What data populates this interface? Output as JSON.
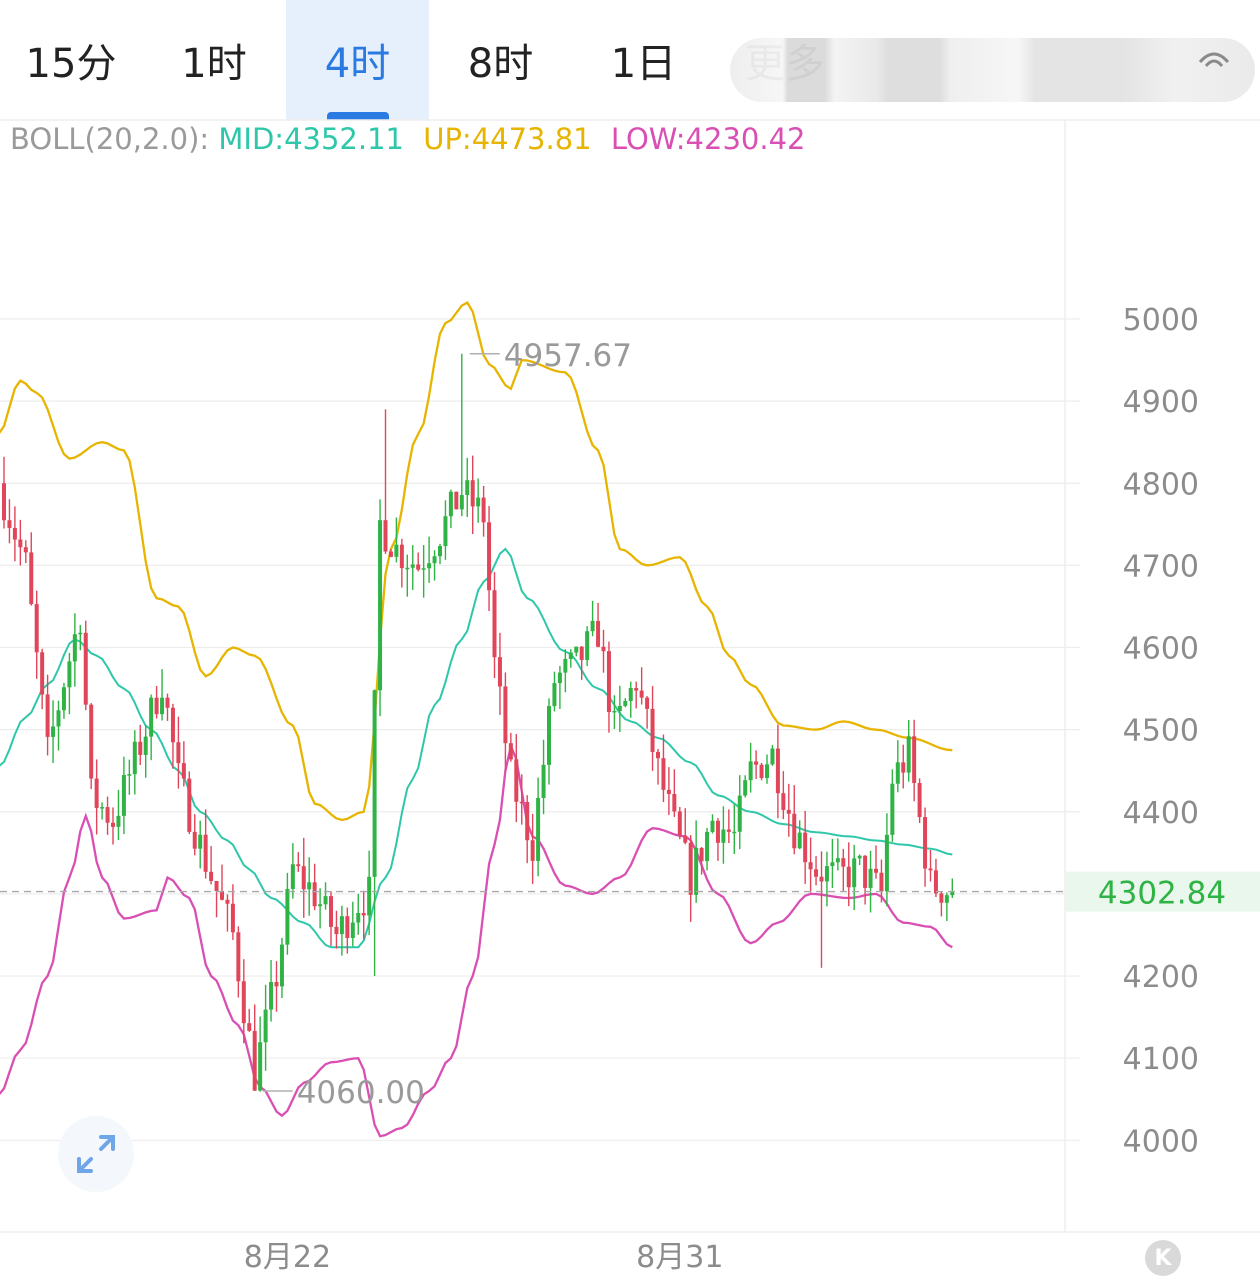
{
  "tabs": [
    {
      "label": "15分",
      "active": false
    },
    {
      "label": "1时",
      "active": false
    },
    {
      "label": "4时",
      "active": true
    },
    {
      "label": "8时",
      "active": false
    },
    {
      "label": "1日",
      "active": false
    }
  ],
  "more_tab_partial": "更多",
  "boll": {
    "label": "BOLL(20,2.0):",
    "mid": "MID:4352.11",
    "up": "UP:4473.81",
    "low": "LOW:4230.42"
  },
  "colors": {
    "up_candle": "#2fb344",
    "down_candle": "#e0455a",
    "mid_line": "#2fc7a9",
    "upper_band": "#e7b400",
    "lower_band": "#d94fb4",
    "current_price": "#2fb344",
    "accent": "#2a7ae2"
  },
  "chart_data": {
    "type": "candlestick",
    "indicator": "BOLL(20,2.0)",
    "y_ticks": [
      "5000",
      "4900",
      "4800",
      "4700",
      "4600",
      "4500",
      "4400",
      "4200",
      "4100",
      "4000"
    ],
    "y_range": [
      3935,
      5150
    ],
    "x_labels": [
      {
        "label": "8月22",
        "index": 52
      },
      {
        "label": "8月31",
        "index": 124
      }
    ],
    "current_price": 4302.84,
    "current_price_label": "4302.84",
    "high_label": "4957.67",
    "high_index": 84,
    "low_label": "4060.00",
    "low_index": 46,
    "last_index": 174
  },
  "icons": {
    "settings": "settings-icon",
    "expand": "expand-icon",
    "kline": "kline-icon"
  },
  "kline_letter": "K"
}
